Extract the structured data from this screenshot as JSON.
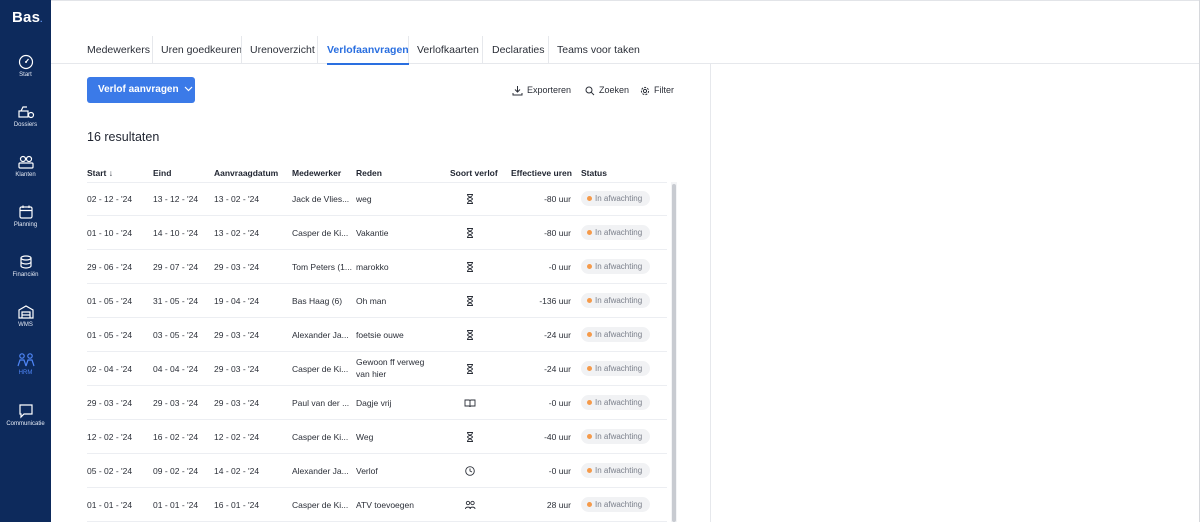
{
  "app": {
    "logo": "Bas",
    "logo_dot": "."
  },
  "sidebar": {
    "items": [
      {
        "label": "Start",
        "icon": "gauge-icon"
      },
      {
        "label": "Dossiers",
        "icon": "dossiers-icon"
      },
      {
        "label": "Klanten",
        "icon": "customers-icon"
      },
      {
        "label": "Planning",
        "icon": "calendar-icon"
      },
      {
        "label": "Financiën",
        "icon": "coins-icon"
      },
      {
        "label": "WMS",
        "icon": "warehouse-icon"
      },
      {
        "label": "HRM",
        "icon": "people-icon",
        "active": true
      },
      {
        "label": "Communicatie",
        "icon": "chat-icon"
      }
    ]
  },
  "tabs": [
    {
      "label": "Medewerkers"
    },
    {
      "label": "Uren goedkeuren"
    },
    {
      "label": "Urenoverzicht"
    },
    {
      "label": "Verlofaanvragen",
      "active": true
    },
    {
      "label": "Verlofkaarten"
    },
    {
      "label": "Declaraties"
    },
    {
      "label": "Teams voor taken"
    }
  ],
  "toolbar": {
    "primary_label": "Verlof aanvragen",
    "export_label": "Exporteren",
    "search_label": "Zoeken",
    "filter_label": "Filter"
  },
  "results_label": "16 resultaten",
  "table": {
    "columns": [
      "Start",
      "Eind",
      "Aanvraagdatum",
      "Medewerker",
      "Reden",
      "Soort verlof",
      "Effectieve uren",
      "Status"
    ],
    "sort_indicator": "↓",
    "rows": [
      {
        "start": "02 - 12 - '24",
        "end": "13 - 12 - '24",
        "requested": "13 - 02 - '24",
        "employee": "Jack de Vlies...",
        "reason": "weg",
        "type_icon": "hourglass-icon",
        "hours": "-80 uur",
        "status": "In afwachting"
      },
      {
        "start": "01 - 10 - '24",
        "end": "14 - 10 - '24",
        "requested": "13 - 02 - '24",
        "employee": "Casper de Ki...",
        "reason": "Vakantie",
        "type_icon": "hourglass-icon",
        "hours": "-80 uur",
        "status": "In afwachting"
      },
      {
        "start": "29 - 06 - '24",
        "end": "29 - 07 - '24",
        "requested": "29 - 03 - '24",
        "employee": "Tom Peters (1...",
        "reason": "marokko",
        "type_icon": "hourglass-icon",
        "hours": "-0 uur",
        "status": "In afwachting"
      },
      {
        "start": "01 - 05 - '24",
        "end": "31 - 05 - '24",
        "requested": "19 - 04 - '24",
        "employee": "Bas Haag (6)",
        "reason": "Oh man",
        "type_icon": "hourglass-icon",
        "hours": "-136 uur",
        "status": "In afwachting"
      },
      {
        "start": "01 - 05 - '24",
        "end": "03 - 05 - '24",
        "requested": "29 - 03 - '24",
        "employee": "Alexander Ja...",
        "reason": "foetsie ouwe",
        "type_icon": "hourglass-icon",
        "hours": "-24 uur",
        "status": "In afwachting"
      },
      {
        "start": "02 - 04 - '24",
        "end": "04 - 04 - '24",
        "requested": "29 - 03 - '24",
        "employee": "Casper de Ki...",
        "reason": "Gewoon ff verweg van hier",
        "type_icon": "hourglass-icon",
        "hours": "-24 uur",
        "status": "In afwachting"
      },
      {
        "start": "29 - 03 - '24",
        "end": "29 - 03 - '24",
        "requested": "29 - 03 - '24",
        "employee": "Paul van der ...",
        "reason": "Dagje vrij",
        "type_icon": "book-icon",
        "hours": "-0 uur",
        "status": "In afwachting"
      },
      {
        "start": "12 - 02 - '24",
        "end": "16 - 02 - '24",
        "requested": "12 - 02 - '24",
        "employee": "Casper de Ki...",
        "reason": "Weg",
        "type_icon": "hourglass-icon",
        "hours": "-40 uur",
        "status": "In afwachting"
      },
      {
        "start": "05 - 02 - '24",
        "end": "09 - 02 - '24",
        "requested": "14 - 02 - '24",
        "employee": "Alexander Ja...",
        "reason": "Verlof",
        "type_icon": "clock-icon",
        "hours": "-0 uur",
        "status": "In afwachting"
      },
      {
        "start": "01 - 01 - '24",
        "end": "01 - 01 - '24",
        "requested": "16 - 01 - '24",
        "employee": "Casper de Ki...",
        "reason": "ATV toevoegen",
        "type_icon": "people-icon",
        "hours": "28 uur",
        "status": "In afwachting"
      }
    ]
  }
}
